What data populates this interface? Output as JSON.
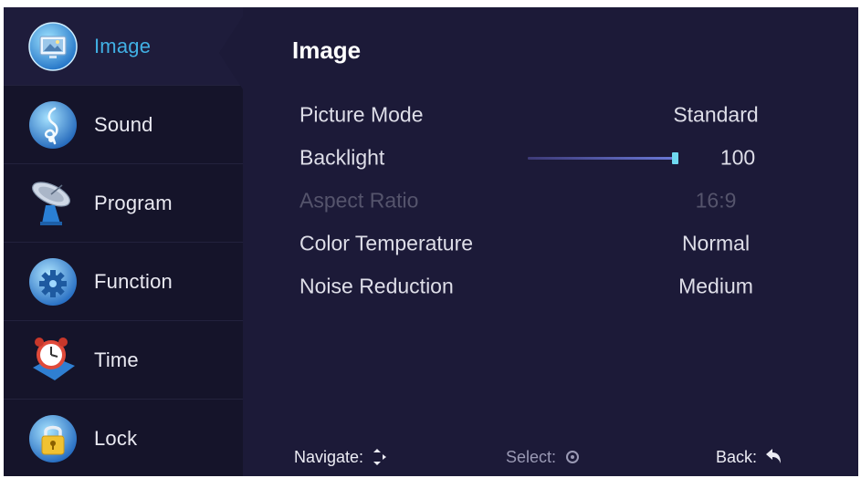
{
  "sidebar": {
    "items": [
      {
        "label": "Image",
        "icon": "image-icon",
        "active": true
      },
      {
        "label": "Sound",
        "icon": "music-note-icon",
        "active": false
      },
      {
        "label": "Program",
        "icon": "satellite-dish-icon",
        "active": false
      },
      {
        "label": "Function",
        "icon": "gear-icon",
        "active": false
      },
      {
        "label": "Time",
        "icon": "alarm-clock-icon",
        "active": false
      },
      {
        "label": "Lock",
        "icon": "padlock-icon",
        "active": false
      }
    ]
  },
  "main": {
    "title": "Image",
    "settings": [
      {
        "label": "Picture Mode",
        "value": "Standard",
        "enabled": true
      },
      {
        "label": "Backlight",
        "value": "100",
        "level": 1.0,
        "enabled": true
      },
      {
        "label": "Aspect Ratio",
        "value": "16:9",
        "enabled": false
      },
      {
        "label": "Color Temperature",
        "value": "Normal",
        "enabled": true
      },
      {
        "label": "Noise Reduction",
        "value": "Medium",
        "enabled": true
      }
    ]
  },
  "footer": {
    "navigate_label": "Navigate:",
    "navigate_icon": "navigate-arrows-icon",
    "select_label": "Select:",
    "select_icon": "ok-circle-icon",
    "back_label": "Back:",
    "back_icon": "back-arrow-icon"
  },
  "colors": {
    "background": "#1c1a38",
    "sidebar": "#15142a",
    "accent": "#41b0e4",
    "text": "#dedee8",
    "disabled_text": "#55546c",
    "slider_knob": "#6fd9f0"
  }
}
